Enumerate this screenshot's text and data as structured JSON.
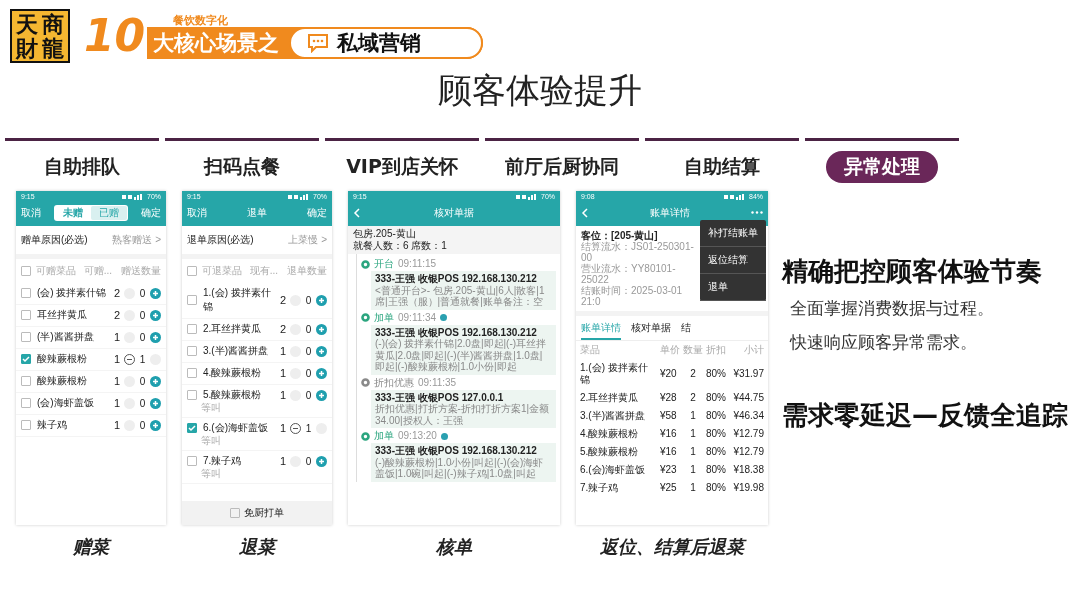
{
  "header": {
    "logo": [
      "天",
      "商",
      "財",
      "龍"
    ],
    "number": "10",
    "subtitle": "餐饮数字化",
    "banner": "大核心场景之",
    "topic": "私域营销"
  },
  "title": "顾客体验提升",
  "tabs": [
    {
      "label": "自助排队",
      "selected": false
    },
    {
      "label": "扫码点餐",
      "selected": false
    },
    {
      "label": "VIP到店关怀",
      "selected": false
    },
    {
      "label": "前厅后厨协同",
      "selected": false
    },
    {
      "label": "自助结算",
      "selected": false
    },
    {
      "label": "异常处理",
      "selected": true
    }
  ],
  "phones": [
    {
      "kind": "order_form",
      "caption": "赠菜",
      "status": {
        "time": "9:15",
        "battery": "70%"
      },
      "cancel": "取消",
      "segments": [
        {
          "label": "未赠",
          "selected": true
        },
        {
          "label": "已赠",
          "selected": false
        }
      ],
      "confirm": "确定",
      "reason": {
        "label": "赠单原因(必选)",
        "value": "熟客赠送 >"
      },
      "columns": [
        "可赠菜品",
        "可赠...",
        "赠送数量"
      ],
      "select_all": false,
      "items": [
        {
          "name": "(会) 拨拌素什锦",
          "qty": "2",
          "count": "0",
          "checked": false
        },
        {
          "name": "耳丝拌黄瓜",
          "qty": "2",
          "count": "0",
          "checked": false
        },
        {
          "name": "(半)酱酱拼盘",
          "qty": "1",
          "count": "0",
          "checked": false
        },
        {
          "name": "酸辣蕨根粉",
          "qty": "1",
          "count": "1",
          "checked": true
        },
        {
          "name": "酸辣蕨根粉",
          "qty": "1",
          "count": "0",
          "checked": false
        },
        {
          "name": "(会)海虾盖饭",
          "qty": "1",
          "count": "0",
          "checked": false
        },
        {
          "name": "辣子鸡",
          "qty": "1",
          "count": "0",
          "checked": false
        }
      ]
    },
    {
      "kind": "order_form",
      "caption": "退菜",
      "status": {
        "time": "9:15",
        "battery": "70%"
      },
      "cancel": "取消",
      "title": "退单",
      "confirm": "确定",
      "reason": {
        "label": "退单原因(必选)",
        "value": "上菜慢 >"
      },
      "columns": [
        "可退菜品",
        "现有...",
        "退单数量"
      ],
      "select_all": false,
      "items": [
        {
          "name": "1.(会) 拨拌素什锦",
          "qty": "2",
          "count": "0",
          "checked": false
        },
        {
          "name": "2.耳丝拌黄瓜",
          "qty": "2",
          "count": "0",
          "checked": false
        },
        {
          "name": "3.(半)酱酱拼盘",
          "qty": "1",
          "count": "0",
          "checked": false
        },
        {
          "name": "4.酸辣蕨根粉",
          "qty": "1",
          "count": "0",
          "checked": false
        },
        {
          "name": "5.酸辣蕨根粉",
          "qty": "1",
          "count": "0",
          "checked": false,
          "note": "等叫"
        },
        {
          "name": "6.(会)海虾盖饭",
          "qty": "1",
          "count": "1",
          "checked": true,
          "note": "等叫"
        },
        {
          "name": "7.辣子鸡",
          "qty": "1",
          "count": "0",
          "checked": false,
          "note": "等叫"
        }
      ],
      "footer": {
        "label": "免厨打单",
        "checked": false
      }
    },
    {
      "kind": "timeline",
      "caption": "核单",
      "status": {
        "time": "9:15",
        "battery": "70%"
      },
      "title": "核对单据",
      "room": "包房.205-黄山",
      "guests": "就餐人数：6  席数：1",
      "events": [
        {
          "label": "开台",
          "time": "09:11:15",
          "color": "#2ba57f",
          "marked": false,
          "head": "333-王强  收银POS  192.168.130.212",
          "detail": "<普通开台>- 包房.205-黄山|6人|散客|1席|王强（服）|普通就餐|账单备注：空"
        },
        {
          "label": "加单",
          "time": "09:11:34",
          "color": "#2ba57f",
          "marked": true,
          "head": "333-王强  收银POS  192.168.130.212",
          "detail": "(-)(会) 拨拌素什锦|2.0盘|即起|(-)耳丝拌黄瓜|2.0盘|即起|(-)(半)酱酱拼盘|1.0盘|即起|(-)酸辣蕨根粉|1.0小份|即起"
        },
        {
          "label": "折扣优惠",
          "time": "09:11:35",
          "color": "#8a8a8a",
          "marked": false,
          "head": "333-王强  收银POS  127.0.0.1",
          "detail": "折扣优惠|打折方案-折扣打折方案1|金额34.00|授权人：王强"
        },
        {
          "label": "加单",
          "time": "09:13:20",
          "color": "#2ba57f",
          "marked": true,
          "head": "333-王强  收银POS  192.168.130.212",
          "detail": "(-)酸辣蕨根粉|1.0小份|叫起|(-)(会)海虾盖饭|1.0碗|叫起|(-)辣子鸡|1.0盘|叫起"
        }
      ]
    },
    {
      "kind": "bill",
      "caption": "返位、结算后退菜",
      "status": {
        "time": "9:08",
        "battery": "84%"
      },
      "title": "账单详情",
      "seat": "客位：[205-黄山]",
      "info": [
        "结算流水：JS01-250301-00",
        "营业流水：YY80101-25022",
        "结账时间：2025-03-01 21:0"
      ],
      "menu": [
        "补打结账单",
        "返位结算",
        "退单"
      ],
      "tabs": [
        {
          "label": "账单详情",
          "selected": true
        },
        {
          "label": "核对单据",
          "selected": false
        },
        {
          "label": "结",
          "selected": false
        }
      ],
      "columns": [
        "菜品",
        "单价",
        "数量",
        "折扣",
        "小计"
      ],
      "rows": [
        [
          "1.(会) 拨拌素什锦",
          "¥20",
          "2",
          "80%",
          "¥31.97"
        ],
        [
          "2.耳丝拌黄瓜",
          "¥28",
          "2",
          "80%",
          "¥44.75"
        ],
        [
          "3.(半)酱酱拼盘",
          "¥58",
          "1",
          "80%",
          "¥46.34"
        ],
        [
          "4.酸辣蕨根粉",
          "¥16",
          "1",
          "80%",
          "¥12.79"
        ],
        [
          "5.酸辣蕨根粉",
          "¥16",
          "1",
          "80%",
          "¥12.79"
        ],
        [
          "6.(会)海虾盖饭",
          "¥23",
          "1",
          "80%",
          "¥18.38"
        ],
        [
          "7.辣子鸡",
          "¥25",
          "1",
          "80%",
          "¥19.98"
        ]
      ]
    }
  ],
  "highlights": [
    {
      "kind": "heading",
      "text": "精确把控顾客体验节奏"
    },
    {
      "kind": "line",
      "text": "全面掌握消费数据与过程。"
    },
    {
      "kind": "line",
      "text": "快速响应顾客异常需求。"
    },
    {
      "kind": "heading",
      "text": "需求零延迟—反馈全追踪"
    }
  ]
}
